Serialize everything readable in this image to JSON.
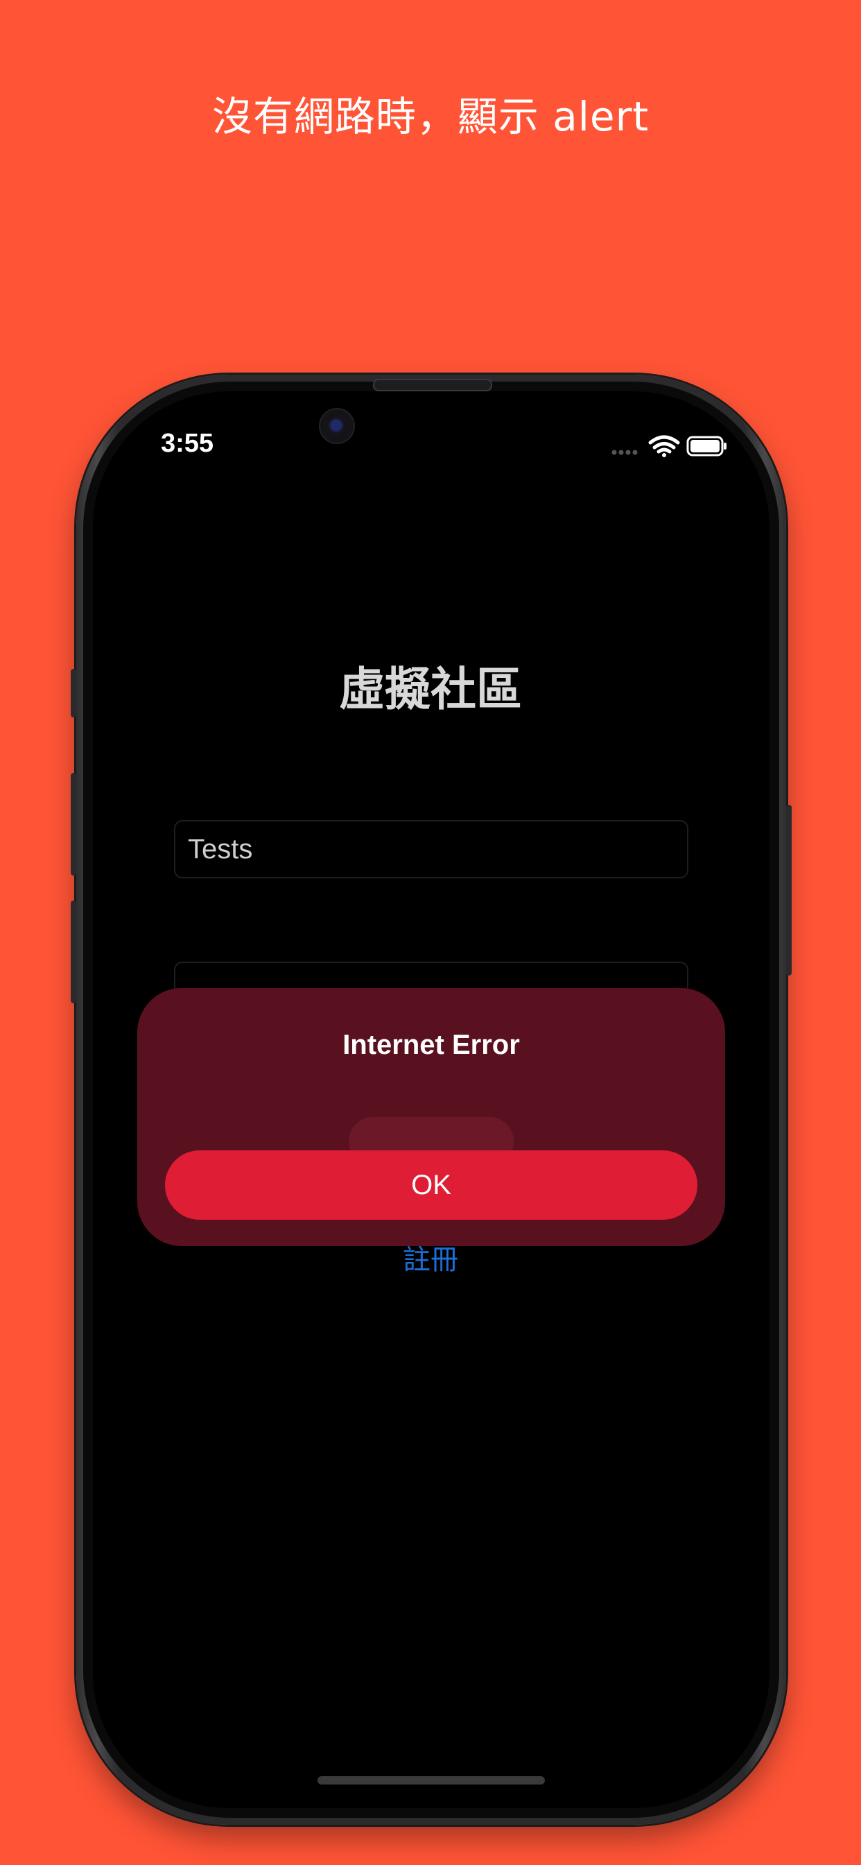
{
  "promo": {
    "headline": "沒有網路時，顯示 alert"
  },
  "status_bar": {
    "time": "3:55",
    "icons": [
      "signal-dots-icon",
      "wifi-icon",
      "battery-icon"
    ]
  },
  "app": {
    "title": "虛擬社區",
    "username_value": "Tests",
    "password_masked": "●●●●●●",
    "register_link": "註冊"
  },
  "alert": {
    "title": "Internet Error",
    "ok_label": "OK"
  },
  "colors": {
    "background": "#FF5436",
    "alert_bg": "#5A111F",
    "ok_button": "#DF1E36",
    "link": "#1B6FD6"
  }
}
